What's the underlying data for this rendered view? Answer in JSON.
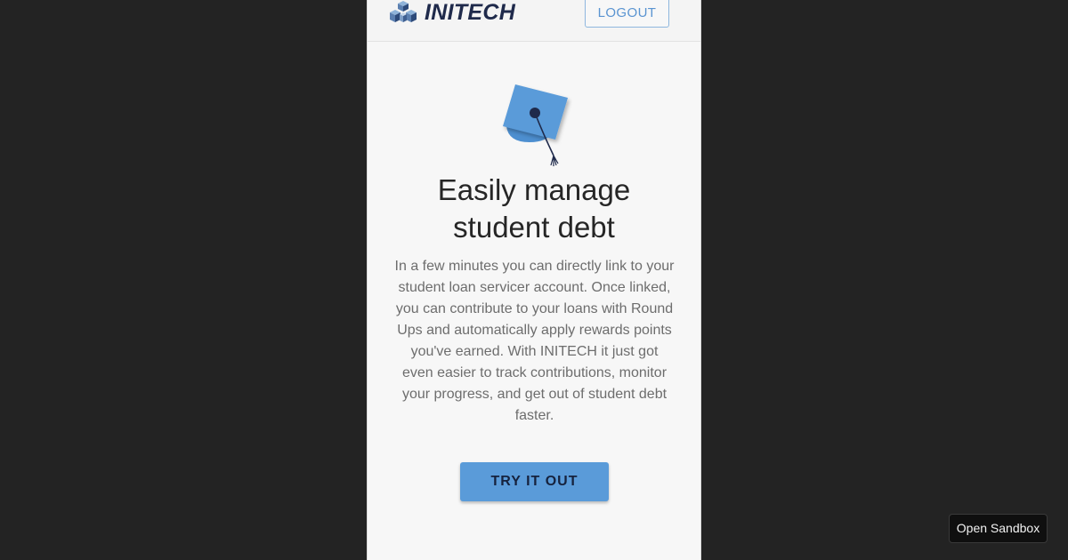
{
  "app": {
    "brand_name": "INITECH",
    "logo_icon": "cubes-logo-icon"
  },
  "header": {
    "logout_label": "LOGOUT"
  },
  "hero": {
    "illustration_icon": "graduation-cap-icon",
    "title_line1": "Easily manage",
    "title_line2": "student debt",
    "description": "In a few minutes you can directly link to your student loan servicer account. Once linked, you can contribute to your loans with Round Ups and automatically apply rewards points you've earned. With INITECH it just got even easier to track contributions, monitor your progress, and get out of student debt faster.",
    "cta_label": "TRY IT OUT"
  },
  "overlay": {
    "sandbox_label": "Open Sandbox"
  },
  "colors": {
    "page_background": "#232323",
    "panel_background": "#f7f7f7",
    "brand_text": "#1f2a4b",
    "accent_blue": "#5a9bd9",
    "logout_text": "#5a94d1",
    "body_text": "#6d6d6d",
    "title_text": "#262626"
  }
}
